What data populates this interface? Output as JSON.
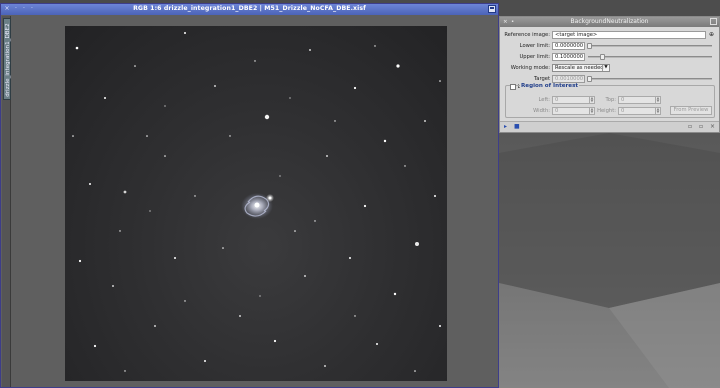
{
  "image_window": {
    "title": "RGB 1:6 drizzle_integration1_DBE2 | M51_Drizzle_NoCFA_DBE.xisf",
    "view_tab": "drizzle_integration1_DBE2",
    "titlebar_buttons": [
      "×",
      "·",
      "·",
      "·"
    ]
  },
  "process_panel": {
    "title": "BackgroundNeutralization",
    "reference_image": {
      "label": "Reference image:",
      "value": "<target image>"
    },
    "lower_limit": {
      "label": "Lower limit:",
      "value": "0.0000000"
    },
    "upper_limit": {
      "label": "Upper limit:",
      "value": "0.1000000"
    },
    "working_mode": {
      "label": "Working mode:",
      "value": "Rescale as needed"
    },
    "target_background": {
      "label": "Target background:",
      "value": "0.0010000"
    },
    "roi": {
      "title": "Region of Interest",
      "left": {
        "label": "Left:",
        "value": "0"
      },
      "top": {
        "label": "Top:",
        "value": "0"
      },
      "width": {
        "label": "Width:",
        "value": "0"
      },
      "height": {
        "label": "Height:",
        "value": "0"
      },
      "preview_button": "From Preview"
    }
  },
  "colors": {
    "image_titlebar": "#5b73c7",
    "panel_bg": "#d8d8d8",
    "roi_title": "#1f3d8a"
  }
}
